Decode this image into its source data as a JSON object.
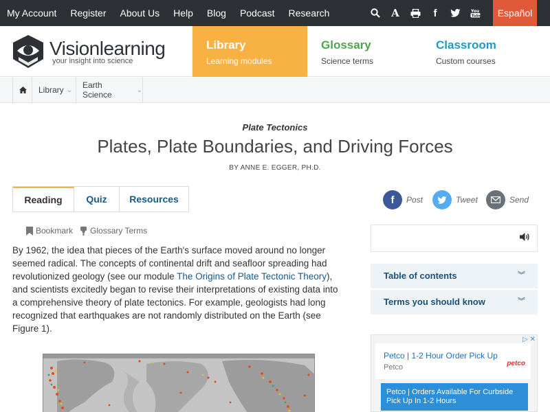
{
  "topbar": {
    "links": [
      "My Account",
      "Register",
      "About Us",
      "Help",
      "Blog",
      "Podcast",
      "Research"
    ],
    "icons": [
      "search-icon",
      "font-size-icon",
      "print-icon",
      "facebook-icon",
      "twitter-icon",
      "youtube-icon"
    ],
    "language": "Español"
  },
  "header": {
    "logo_text": "Visionlearning",
    "tagline": "your insight into science",
    "nav": [
      {
        "title": "Library",
        "subtitle": "Learning modules"
      },
      {
        "title": "Glossary",
        "subtitle": "Science terms"
      },
      {
        "title": "Classroom",
        "subtitle": "Custom courses"
      }
    ]
  },
  "breadcrumb": {
    "home_icon": "home-icon",
    "items": [
      "Library",
      "Earth Science"
    ]
  },
  "article": {
    "kicker": "Plate Tectonics",
    "title": "Plates, Plate Boundaries, and Driving Forces",
    "byline": "BY ANNE E. EGGER, PH.D.",
    "tabs": [
      "Reading",
      "Quiz",
      "Resources"
    ],
    "tools": [
      "Bookmark",
      "Glossary Terms"
    ],
    "para_before": "By 1962, the idea that pieces of the Earth's surface moved around no longer seemed radical. The concepts of continental drift and seafloor spreading had revolutionized geology (see our module ",
    "link": "The Origins of Plate Tectonic Theory",
    "para_after": "), and scientists excitedly began to revise their interpretations of existing data into a comprehensive theory of plate tectonics. For example, geologists had long recognized that earthquakes are not randomly distributed on the Earth (see Figure 1)."
  },
  "share": [
    {
      "label": "Post",
      "icon": "facebook-icon",
      "color": "#3b5998",
      "glyph": "f"
    },
    {
      "label": "Tweet",
      "icon": "twitter-icon",
      "color": "#55acee",
      "glyph": "t"
    },
    {
      "label": "Send",
      "icon": "email-icon",
      "color": "#6a7178",
      "glyph": "✉"
    }
  ],
  "sidebar": {
    "accordion": [
      "Table of contents",
      "Terms you should know"
    ]
  },
  "ad": {
    "headline": "Petco | 1-2 Hour Order Pick Up",
    "source": "Petco",
    "brand": "petco",
    "cta": "Petco | Orders Available For Curbside Pick Up In 1-2 Hours"
  },
  "colors": {
    "topbar": "#2d3035",
    "espanol": "#e05a3a",
    "library": "#f8b244",
    "glossary": "#4ea64b",
    "classroom": "#1e9bc4",
    "link": "#1a5a8a"
  }
}
